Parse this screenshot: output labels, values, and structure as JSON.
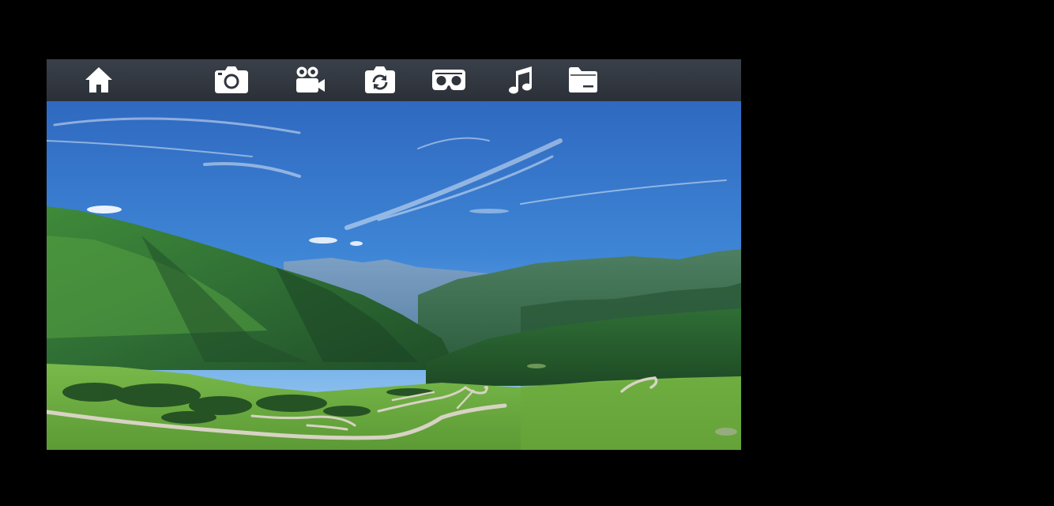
{
  "toolbar": {
    "items": [
      {
        "id": "home",
        "icon": "home-icon"
      },
      {
        "id": "camera",
        "icon": "camera-icon"
      },
      {
        "id": "video",
        "icon": "video-camera-icon"
      },
      {
        "id": "switch-camera",
        "icon": "camera-switch-icon"
      },
      {
        "id": "vr",
        "icon": "vr-headset-icon"
      },
      {
        "id": "music",
        "icon": "music-note-icon"
      },
      {
        "id": "files",
        "icon": "folder-icon"
      }
    ],
    "icon_color": "#ffffff",
    "background": "#30353d"
  },
  "preview": {
    "content": "mountain-valley-landscape-photo",
    "sky_color": "#2f74c9",
    "grass_color": "#6fb33a"
  }
}
